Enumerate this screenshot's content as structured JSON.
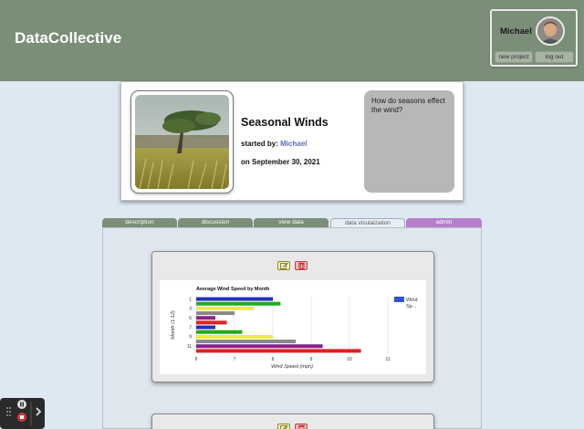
{
  "header": {
    "brand": "DataCollective",
    "user": {
      "name": "Michael",
      "new_project_label": "new project",
      "logout_label": "log out"
    }
  },
  "project": {
    "title": "Seasonal Winds",
    "started_by_label": "started by:",
    "started_by_name": "Michael",
    "date_text": "on September 30, 2021",
    "question": "How do seasons effect the wind?"
  },
  "tabs": [
    {
      "label": "description",
      "active": false
    },
    {
      "label": "discussion",
      "active": false
    },
    {
      "label": "view data",
      "active": false
    },
    {
      "label": "data visulaization",
      "active": true
    },
    {
      "label": "admin",
      "active": false
    }
  ],
  "colors": {
    "header_bg": "#7b8e78",
    "page_bg": "#dde8f3",
    "admin_tab": "#b77fc9",
    "link": "#5c6fb3"
  },
  "icons": [
    "edit-icon",
    "trash-icon",
    "pause-icon",
    "stop-icon",
    "drag-handle-icon",
    "chevron-right-icon"
  ],
  "chart_data": {
    "type": "bar",
    "orientation": "horizontal",
    "title": "Average Wind Speed by Month",
    "xlabel": "Wind Speed (mph)",
    "ylabel": "Month (1-12)",
    "xlim": [
      6,
      11
    ],
    "xticks": [
      "6",
      "7",
      "8",
      "9",
      "10",
      "11"
    ],
    "yticks_shown": [
      "1",
      "3",
      "5",
      "7",
      "9",
      "11"
    ],
    "categories": [
      "1",
      "2",
      "3",
      "4",
      "5",
      "6",
      "7",
      "8",
      "9",
      "10",
      "11",
      "12"
    ],
    "values": [
      8.0,
      8.2,
      7.5,
      7.0,
      6.5,
      6.8,
      6.5,
      7.2,
      8.0,
      8.6,
      9.3,
      10.3
    ],
    "bar_colors": [
      "#2233bb",
      "#22aa22",
      "#eeee33",
      "#888888",
      "#882288",
      "#dd2222",
      "#2233bb",
      "#22aa22",
      "#eeee33",
      "#888888",
      "#882288",
      "#dd2222"
    ],
    "legend": {
      "position": "right",
      "label": "Wind Sp...",
      "color": "#3355cc"
    },
    "grid": true
  }
}
